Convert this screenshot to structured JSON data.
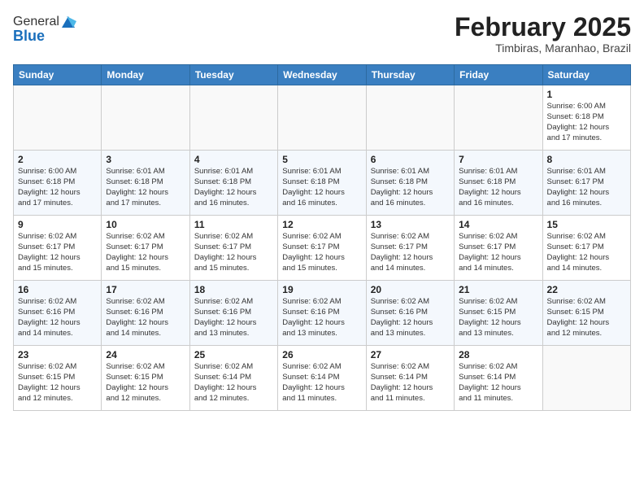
{
  "header": {
    "logo_line1": "General",
    "logo_line2": "Blue",
    "month": "February 2025",
    "location": "Timbiras, Maranhao, Brazil"
  },
  "days_of_week": [
    "Sunday",
    "Monday",
    "Tuesday",
    "Wednesday",
    "Thursday",
    "Friday",
    "Saturday"
  ],
  "weeks": [
    [
      {
        "day": "",
        "info": ""
      },
      {
        "day": "",
        "info": ""
      },
      {
        "day": "",
        "info": ""
      },
      {
        "day": "",
        "info": ""
      },
      {
        "day": "",
        "info": ""
      },
      {
        "day": "",
        "info": ""
      },
      {
        "day": "1",
        "info": "Sunrise: 6:00 AM\nSunset: 6:18 PM\nDaylight: 12 hours\nand 17 minutes."
      }
    ],
    [
      {
        "day": "2",
        "info": "Sunrise: 6:00 AM\nSunset: 6:18 PM\nDaylight: 12 hours\nand 17 minutes."
      },
      {
        "day": "3",
        "info": "Sunrise: 6:01 AM\nSunset: 6:18 PM\nDaylight: 12 hours\nand 17 minutes."
      },
      {
        "day": "4",
        "info": "Sunrise: 6:01 AM\nSunset: 6:18 PM\nDaylight: 12 hours\nand 16 minutes."
      },
      {
        "day": "5",
        "info": "Sunrise: 6:01 AM\nSunset: 6:18 PM\nDaylight: 12 hours\nand 16 minutes."
      },
      {
        "day": "6",
        "info": "Sunrise: 6:01 AM\nSunset: 6:18 PM\nDaylight: 12 hours\nand 16 minutes."
      },
      {
        "day": "7",
        "info": "Sunrise: 6:01 AM\nSunset: 6:18 PM\nDaylight: 12 hours\nand 16 minutes."
      },
      {
        "day": "8",
        "info": "Sunrise: 6:01 AM\nSunset: 6:17 PM\nDaylight: 12 hours\nand 16 minutes."
      }
    ],
    [
      {
        "day": "9",
        "info": "Sunrise: 6:02 AM\nSunset: 6:17 PM\nDaylight: 12 hours\nand 15 minutes."
      },
      {
        "day": "10",
        "info": "Sunrise: 6:02 AM\nSunset: 6:17 PM\nDaylight: 12 hours\nand 15 minutes."
      },
      {
        "day": "11",
        "info": "Sunrise: 6:02 AM\nSunset: 6:17 PM\nDaylight: 12 hours\nand 15 minutes."
      },
      {
        "day": "12",
        "info": "Sunrise: 6:02 AM\nSunset: 6:17 PM\nDaylight: 12 hours\nand 15 minutes."
      },
      {
        "day": "13",
        "info": "Sunrise: 6:02 AM\nSunset: 6:17 PM\nDaylight: 12 hours\nand 14 minutes."
      },
      {
        "day": "14",
        "info": "Sunrise: 6:02 AM\nSunset: 6:17 PM\nDaylight: 12 hours\nand 14 minutes."
      },
      {
        "day": "15",
        "info": "Sunrise: 6:02 AM\nSunset: 6:17 PM\nDaylight: 12 hours\nand 14 minutes."
      }
    ],
    [
      {
        "day": "16",
        "info": "Sunrise: 6:02 AM\nSunset: 6:16 PM\nDaylight: 12 hours\nand 14 minutes."
      },
      {
        "day": "17",
        "info": "Sunrise: 6:02 AM\nSunset: 6:16 PM\nDaylight: 12 hours\nand 14 minutes."
      },
      {
        "day": "18",
        "info": "Sunrise: 6:02 AM\nSunset: 6:16 PM\nDaylight: 12 hours\nand 13 minutes."
      },
      {
        "day": "19",
        "info": "Sunrise: 6:02 AM\nSunset: 6:16 PM\nDaylight: 12 hours\nand 13 minutes."
      },
      {
        "day": "20",
        "info": "Sunrise: 6:02 AM\nSunset: 6:16 PM\nDaylight: 12 hours\nand 13 minutes."
      },
      {
        "day": "21",
        "info": "Sunrise: 6:02 AM\nSunset: 6:15 PM\nDaylight: 12 hours\nand 13 minutes."
      },
      {
        "day": "22",
        "info": "Sunrise: 6:02 AM\nSunset: 6:15 PM\nDaylight: 12 hours\nand 12 minutes."
      }
    ],
    [
      {
        "day": "23",
        "info": "Sunrise: 6:02 AM\nSunset: 6:15 PM\nDaylight: 12 hours\nand 12 minutes."
      },
      {
        "day": "24",
        "info": "Sunrise: 6:02 AM\nSunset: 6:15 PM\nDaylight: 12 hours\nand 12 minutes."
      },
      {
        "day": "25",
        "info": "Sunrise: 6:02 AM\nSunset: 6:14 PM\nDaylight: 12 hours\nand 12 minutes."
      },
      {
        "day": "26",
        "info": "Sunrise: 6:02 AM\nSunset: 6:14 PM\nDaylight: 12 hours\nand 11 minutes."
      },
      {
        "day": "27",
        "info": "Sunrise: 6:02 AM\nSunset: 6:14 PM\nDaylight: 12 hours\nand 11 minutes."
      },
      {
        "day": "28",
        "info": "Sunrise: 6:02 AM\nSunset: 6:14 PM\nDaylight: 12 hours\nand 11 minutes."
      },
      {
        "day": "",
        "info": ""
      }
    ]
  ]
}
